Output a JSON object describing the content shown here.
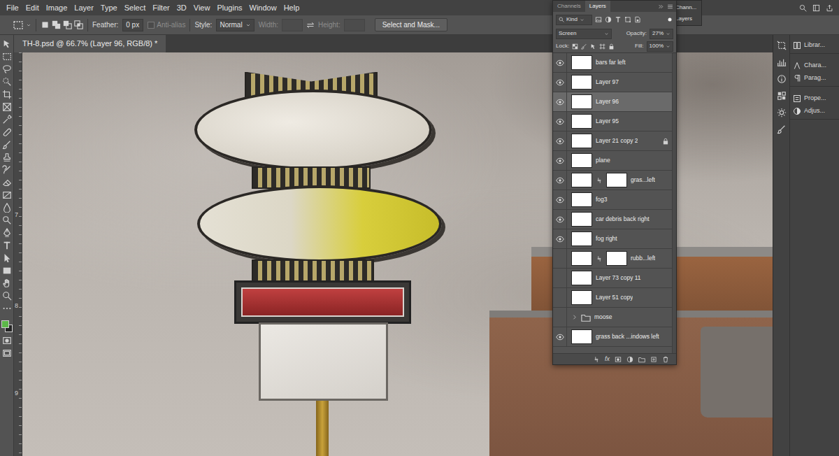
{
  "menu_bar": {
    "items": [
      "File",
      "Edit",
      "Image",
      "Layer",
      "Type",
      "Select",
      "Filter",
      "3D",
      "View",
      "Plugins",
      "Window",
      "Help"
    ]
  },
  "options_bar": {
    "feather_label": "Feather:",
    "feather_value": "0 px",
    "anti_alias_label": "Anti-alias",
    "anti_alias_disabled": true,
    "style_label": "Style:",
    "style_value": "Normal",
    "width_label": "Width:",
    "height_label": "Height:",
    "size_fields_disabled": true,
    "select_and_mask": "Select and Mask..."
  },
  "document_tab": {
    "title": "TH-8.psd @ 66.7% (Layer 96, RGB/8) *"
  },
  "ruler": {
    "ticks": [
      "7",
      "8",
      "9"
    ]
  },
  "swatches": {
    "foreground": "#5cb848",
    "background": "#262626"
  },
  "layers_panel": {
    "tabs": [
      {
        "label": "Channels",
        "selected": false
      },
      {
        "label": "Layers",
        "selected": true
      }
    ],
    "filter": "Kind",
    "blend_mode": "Screen",
    "opacity_label": "Opacity:",
    "opacity": "27%",
    "lock_label": "Lock:",
    "fill_label": "Fill:",
    "fill": "100%",
    "fx": "fx",
    "layers": [
      {
        "name": "bars far left",
        "kind": "layer",
        "visible": true,
        "selected": false,
        "locked": false
      },
      {
        "name": "Layer 97",
        "kind": "layer",
        "visible": true,
        "selected": false,
        "locked": false
      },
      {
        "name": "Layer 96",
        "kind": "layer",
        "visible": true,
        "selected": true,
        "locked": false
      },
      {
        "name": "Layer 95",
        "kind": "layer",
        "visible": true,
        "selected": false,
        "locked": false
      },
      {
        "name": "Layer 21 copy 2",
        "kind": "layer",
        "visible": true,
        "selected": false,
        "locked": true
      },
      {
        "name": "plane",
        "kind": "layer",
        "visible": true,
        "selected": false,
        "locked": false
      },
      {
        "name": "gras...left",
        "kind": "masked",
        "visible": true,
        "selected": false,
        "locked": false
      },
      {
        "name": "fog3",
        "kind": "layer",
        "visible": true,
        "selected": false,
        "locked": false
      },
      {
        "name": "car debris back right",
        "kind": "layer",
        "visible": true,
        "selected": false,
        "locked": false
      },
      {
        "name": "fog right",
        "kind": "layer",
        "visible": true,
        "selected": false,
        "locked": false
      },
      {
        "name": "rubb...left",
        "kind": "masked",
        "visible": false,
        "selected": false,
        "locked": false
      },
      {
        "name": "Layer 73 copy 11",
        "kind": "layer",
        "visible": false,
        "selected": false,
        "locked": false
      },
      {
        "name": "Layer 51 copy",
        "kind": "layer",
        "visible": false,
        "selected": false,
        "locked": false
      },
      {
        "name": "moose",
        "kind": "group",
        "visible": false,
        "selected": false,
        "locked": false,
        "expanded": false
      },
      {
        "name": "grass back ...indows left",
        "kind": "layer",
        "visible": true,
        "selected": false,
        "locked": false
      }
    ]
  },
  "collapsed_panels": [
    {
      "label": "Chann..."
    },
    {
      "label": "Layers"
    }
  ],
  "dock": {
    "groups": [
      [
        {
          "label": "Librar..."
        }
      ],
      [
        {
          "label": "Chara..."
        },
        {
          "label": "Parag..."
        }
      ],
      [
        {
          "label": "Prope..."
        },
        {
          "label": "Adjus..."
        }
      ]
    ]
  }
}
